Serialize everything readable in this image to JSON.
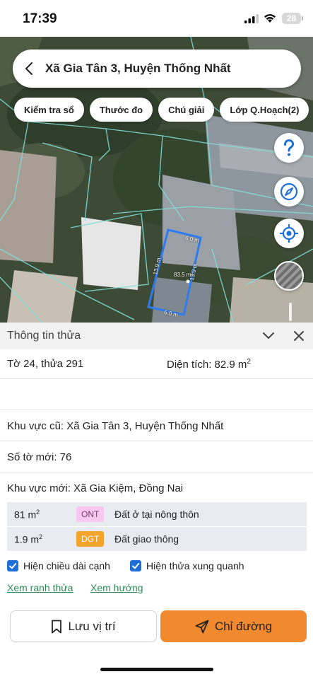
{
  "status_bar": {
    "time": "17:39",
    "battery": "28"
  },
  "map": {
    "search_title": "Xã Gia Tân 3, Huyện Thống Nhất",
    "chips": [
      "Kiểm tra sổ",
      "Thước đo",
      "Chú giải",
      "Lớp Q.Hoạch(2)"
    ],
    "dimensions": {
      "top": "6.0 m",
      "bottom": "6.0 m",
      "left": "13.9 m",
      "right": "13.9 m",
      "area": "83.5 m²"
    },
    "colors": {
      "parcel_border": "#2f7cf0",
      "parcel_lines": "#7fe0d8"
    },
    "icons": {
      "help": "help-icon",
      "compass": "compass-icon",
      "locate": "locate-icon",
      "layer": "layer-thumbnail"
    }
  },
  "panel": {
    "title": "Thông tin thửa",
    "sheet_parcel": "Tờ 24, thửa 291",
    "area_label": "Diện tích: 82.9 m",
    "area_unit_sup": "2",
    "old_area": "Khu vực cũ: Xã Gia Tân 3, Huyện Thống Nhất",
    "new_sheet": "Số tờ mới: 76",
    "new_area": "Khu vực mới: Xã Gia Kiệm, Đồng Nai",
    "land_use": [
      {
        "area": "81 m",
        "sup": "2",
        "code": "ONT",
        "desc": "Đất ở tại nông thôn",
        "code_bg": "#f8c8f0",
        "code_color": "#7a3a70"
      },
      {
        "area": "1.9 m",
        "sup": "2",
        "code": "DGT",
        "desc": "Đất giao thông",
        "code_bg": "#f2a52a",
        "code_color": "#ffffff"
      }
    ],
    "checkboxes": [
      {
        "label": "Hiện chiều dài cạnh",
        "checked": true
      },
      {
        "label": "Hiện thửa xung quanh",
        "checked": true
      }
    ],
    "links": [
      "Xem ranh thửa",
      "Xem hướng"
    ],
    "buttons": {
      "save": "Lưu vị trí",
      "directions": "Chỉ đường"
    },
    "accent_colors": {
      "checkbox": "#1f6fd6",
      "link": "#2e8b57",
      "primary_button": "#f18a2e"
    }
  }
}
